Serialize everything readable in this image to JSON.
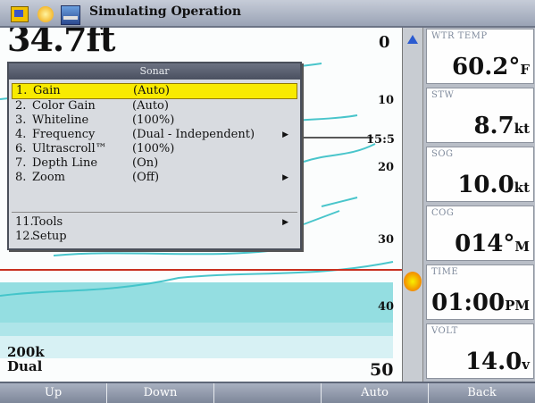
{
  "titlebar": {
    "title": "Simulating Operation"
  },
  "sonar": {
    "depth": "34.7ft",
    "scale_ticks": [
      "0",
      "10",
      "15:5",
      "20",
      "30",
      "40",
      "50"
    ],
    "frequency": "200k",
    "mode": "Dual"
  },
  "menu": {
    "title": "Sonar",
    "items": [
      {
        "num": "1.",
        "label": "Gain",
        "value": "(Auto)",
        "selected": true
      },
      {
        "num": "2.",
        "label": "Color Gain",
        "value": "(Auto)"
      },
      {
        "num": "3.",
        "label": "Whiteline",
        "value": "(100%)"
      },
      {
        "num": "4.",
        "label": "Frequency",
        "value": "(Dual - Independent)",
        "submenu": true
      },
      {
        "num": "6.",
        "label": "Ultrascroll™",
        "value": "(100%)"
      },
      {
        "num": "7.",
        "label": "Depth Line",
        "value": "(On)"
      },
      {
        "num": "8.",
        "label": "Zoom",
        "value": "(Off)",
        "submenu": true
      }
    ],
    "items2": [
      {
        "num": "11.",
        "label": "Tools",
        "submenu": true
      },
      {
        "num": "12.",
        "label": "Setup"
      }
    ]
  },
  "panel": [
    {
      "label": "WTR TEMP",
      "value": "60.2°",
      "unit": "F"
    },
    {
      "label": "STW",
      "value": "8.7",
      "unit": "kt"
    },
    {
      "label": "SOG",
      "value": "10.0",
      "unit": "kt"
    },
    {
      "label": "COG",
      "value": "014°",
      "unit": "M"
    },
    {
      "label": "TIME",
      "value": "01:00",
      "unit": "PM"
    },
    {
      "label": "VOLT",
      "value": "14.0",
      "unit": "v"
    }
  ],
  "softkeys": [
    "Up",
    "Down",
    "",
    "Auto",
    "Back"
  ],
  "colors": {
    "selected": "#f8ea00",
    "depth_line": "#c83020",
    "sonar_returns": "#33c2c8"
  }
}
